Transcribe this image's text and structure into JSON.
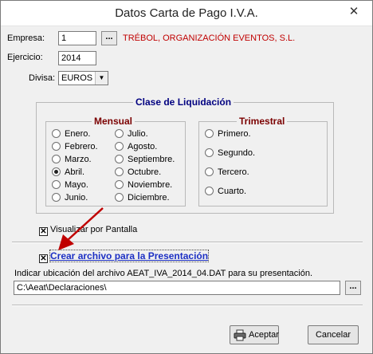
{
  "window": {
    "title": "Datos Carta de Pago I.V.A.",
    "close_symbol": "✕"
  },
  "empresa": {
    "label": "Empresa:",
    "value": "1",
    "browse": "...",
    "name": "TRÉBOL, ORGANIZACIÓN EVENTOS, S.L."
  },
  "ejercicio": {
    "label": "Ejercicio:",
    "value": "2014"
  },
  "divisa": {
    "label": "Divisa:",
    "value": "EUROS",
    "arrow": "▼"
  },
  "clase": {
    "title": "Clase de Liquidación",
    "mensual": {
      "title": "Mensual",
      "months": [
        "Enero.",
        "Febrero.",
        "Marzo.",
        "Abril.",
        "Mayo.",
        "Junio.",
        "Julio.",
        "Agosto.",
        "Septiembre.",
        "Octubre.",
        "Noviembre.",
        "Diciembre."
      ],
      "selected": "Abril."
    },
    "trimestral": {
      "title": "Trimestral",
      "quarters": [
        "Primero.",
        "Segundo.",
        "Tercero.",
        "Cuarto."
      ]
    }
  },
  "visualizar": {
    "label": "Visualizar por Pantalla",
    "checked": true
  },
  "crear_archivo": {
    "label": "Crear archivo para la Presentación",
    "checked": true
  },
  "ubicacion": {
    "label": "Indicar ubicación del archivo AEAT_IVA_2014_04.DAT para su presentación.",
    "path": "C:\\Aeat\\Declaraciones\\",
    "browse": "..."
  },
  "buttons": {
    "aceptar": "Aceptar",
    "cancelar": "Cancelar"
  },
  "colors": {
    "empresa_name": "#c00000",
    "clase_title": "#000080",
    "group_titles": "#7b0000",
    "link": "#1c2fc4",
    "arrow": "#c00000"
  },
  "icons": {
    "printer": "printer-icon",
    "arrow": "red-arrow-annotation"
  }
}
